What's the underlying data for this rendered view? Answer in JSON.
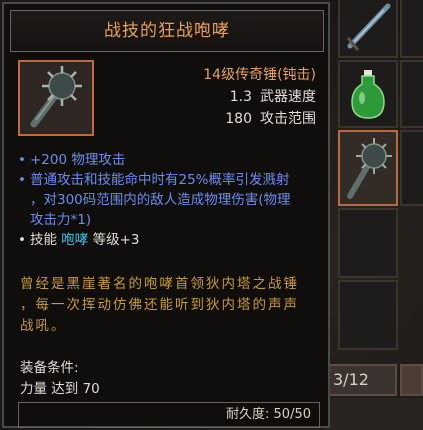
{
  "tooltip": {
    "title": "战技的狂战咆哮",
    "rarity_line": "14级传奇锤(钝击)",
    "stats": [
      {
        "value": "1.3",
        "label": "武器速度"
      },
      {
        "value": "180",
        "label": "攻击范围"
      }
    ],
    "affix_dot": "•",
    "affixes": {
      "physical_attack": "+200 物理攻击",
      "splash_line1": "普通攻击和技能命中时有25%概率引发溅射",
      "splash_line2": "，对300码范围内的敌人造成物理伤害(物理",
      "splash_line3": "攻击力*1)",
      "skill_prefix": "技能",
      "skill_name": "咆哮",
      "skill_suffix": "等级+3"
    },
    "flavor": {
      "line1": "曾经是黑崖著名的咆哮首领狄内塔之战锤",
      "line2": "，每一次挥动仿佛还能听到狄内塔的声声",
      "line3": "战吼。"
    },
    "requirements": {
      "heading": "装备条件:",
      "strength": "力量 达到 70"
    },
    "durability": "耐久度: 50/50"
  },
  "inventory": {
    "stack_counter": "3/12"
  },
  "colors": {
    "legendary": "#e8a060",
    "affix_blue": "#6d8cf0",
    "skill_cyan": "#4cc0e8",
    "flavor_gold": "#c89a40"
  },
  "icons": {
    "item": "spiked-mace-icon",
    "slot_sword": "sword-icon",
    "slot_potion": "green-potion-icon",
    "slot_mace": "spiked-mace-icon"
  }
}
